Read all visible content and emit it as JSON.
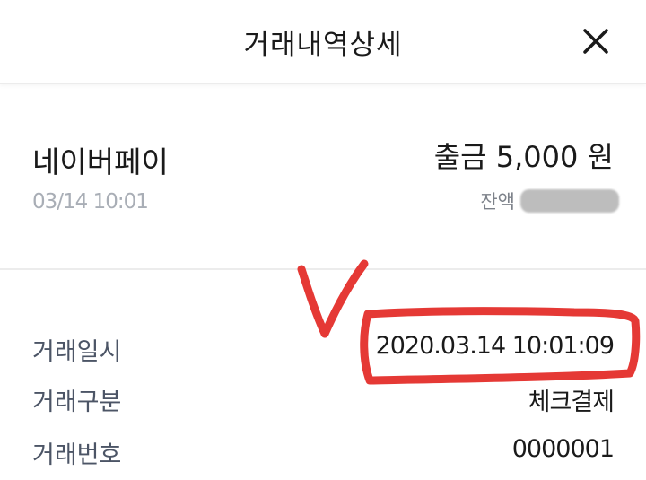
{
  "header": {
    "title": "거래내역상세",
    "close_icon": "close-icon"
  },
  "summary": {
    "merchant": "네이버페이",
    "date": "03/14 10:01",
    "amount": "출금 5,000 원",
    "balance_label": "잔액"
  },
  "details": {
    "rows": [
      {
        "label": "거래일시",
        "value": "2020.03.14 10:01:09"
      },
      {
        "label": "거래구분",
        "value": "체크결제"
      },
      {
        "label": "거래번호",
        "value": "0000001"
      }
    ]
  },
  "annotation": {
    "color": "#e53935",
    "mark": "check-mark",
    "highlight": "highlight-box"
  }
}
